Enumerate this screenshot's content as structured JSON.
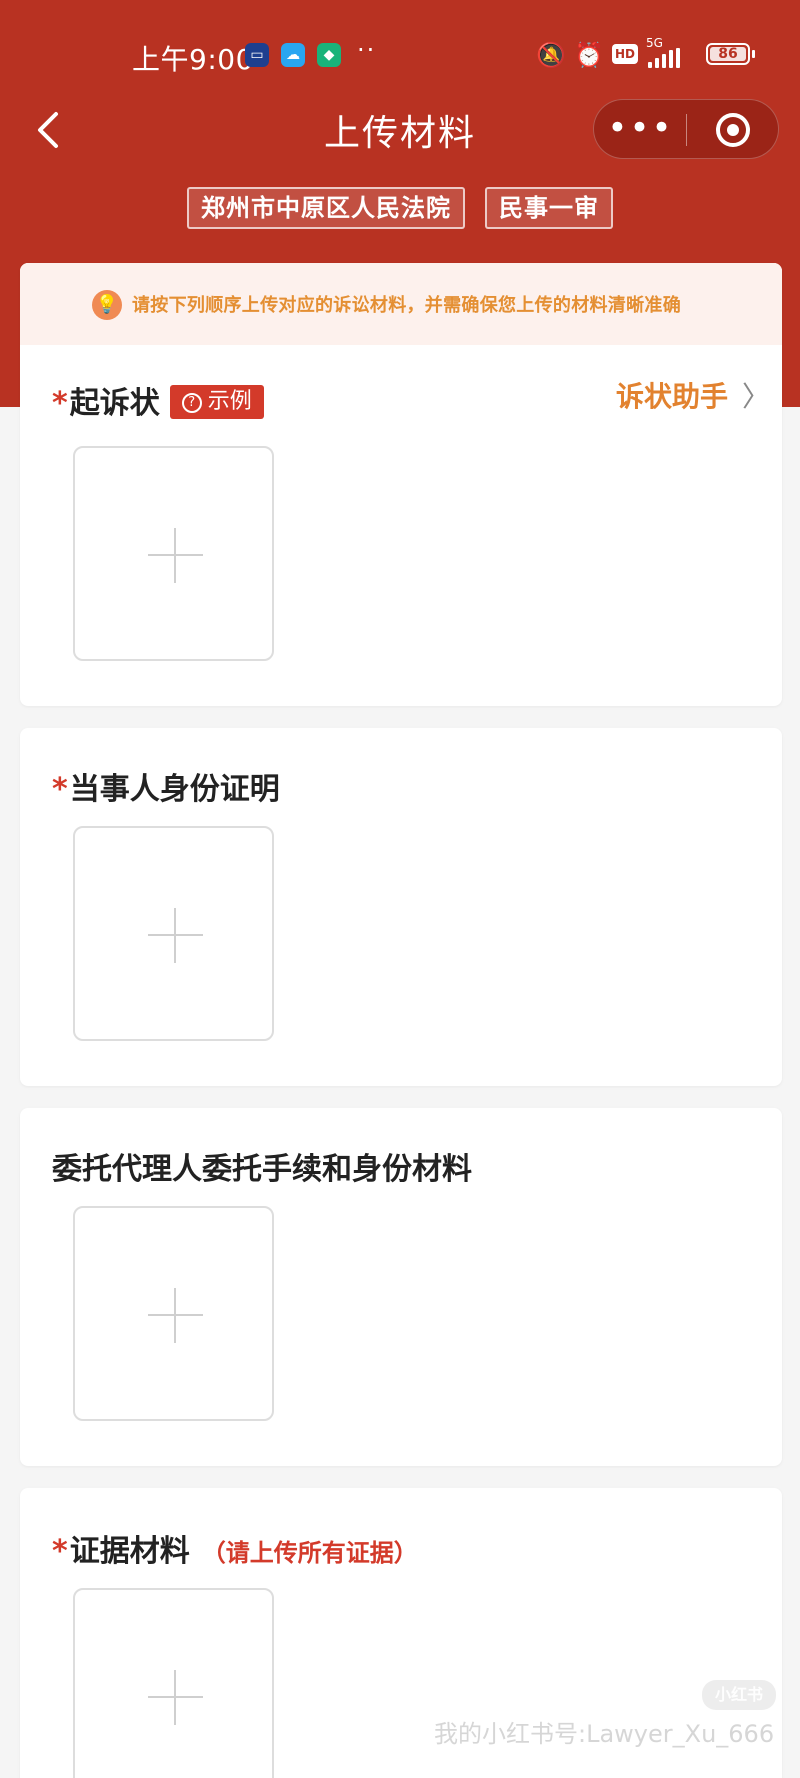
{
  "status_bar": {
    "time": "上午9:00",
    "dots": "··",
    "hd": "HD",
    "network": "5G",
    "battery": "86"
  },
  "nav": {
    "title": "上传材料"
  },
  "tags": [
    "郑州市中原区人民法院",
    "民事一审"
  ],
  "notice": "请按下列顺序上传对应的诉讼材料，并需确保您上传的材料清晰准确",
  "sections": [
    {
      "required": "*",
      "title": "起诉状",
      "example_label": "示例",
      "assistant_label": "诉状助手",
      "assistant_chevron": "〉"
    },
    {
      "required": "*",
      "title": "当事人身份证明"
    },
    {
      "title": "委托代理人委托手续和身份材料"
    },
    {
      "required": "*",
      "title": "证据材料",
      "hint": "（请上传所有证据）"
    }
  ],
  "watermark": {
    "logo": "小红书",
    "text": "我的小红书号:Lawyer_Xu_666"
  },
  "colors": {
    "header_red": "#b83222",
    "required_red": "#d33a2a",
    "assistant_orange": "#e2822f",
    "notice_text": "#e48f33",
    "notice_bg": "#fdf1ed"
  }
}
